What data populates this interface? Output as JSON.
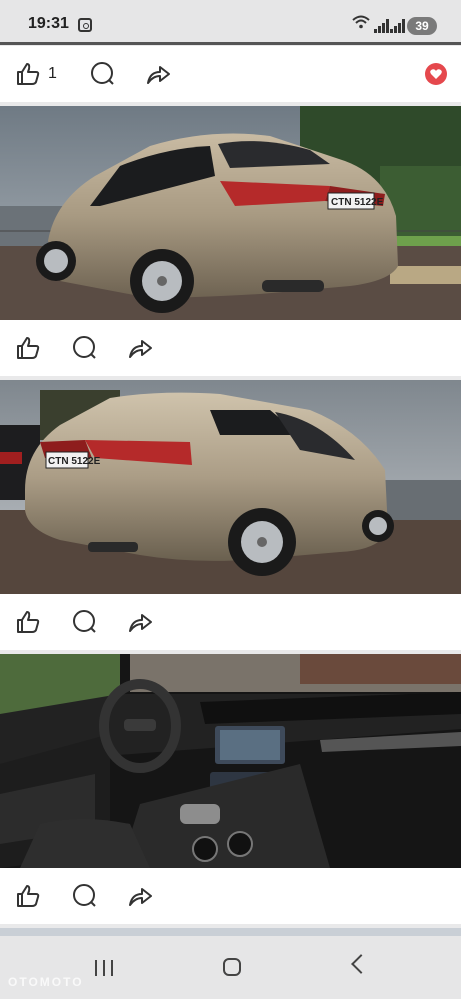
{
  "status_bar": {
    "time": "19:31",
    "battery": "39"
  },
  "post": {
    "like_count": "1",
    "images": [
      {
        "plate_text": "CTN 5122E"
      },
      {
        "plate_text": "CTN 5122E"
      },
      {
        "plate_text": ""
      }
    ]
  },
  "icons": {
    "like": "thumbs-up-icon",
    "comment": "comment-icon",
    "share": "share-icon",
    "reaction": "heart-icon"
  },
  "colors": {
    "reaction_red": "#e5484d",
    "divider": "#e9e9ea"
  },
  "watermark": "OTOMOTO"
}
